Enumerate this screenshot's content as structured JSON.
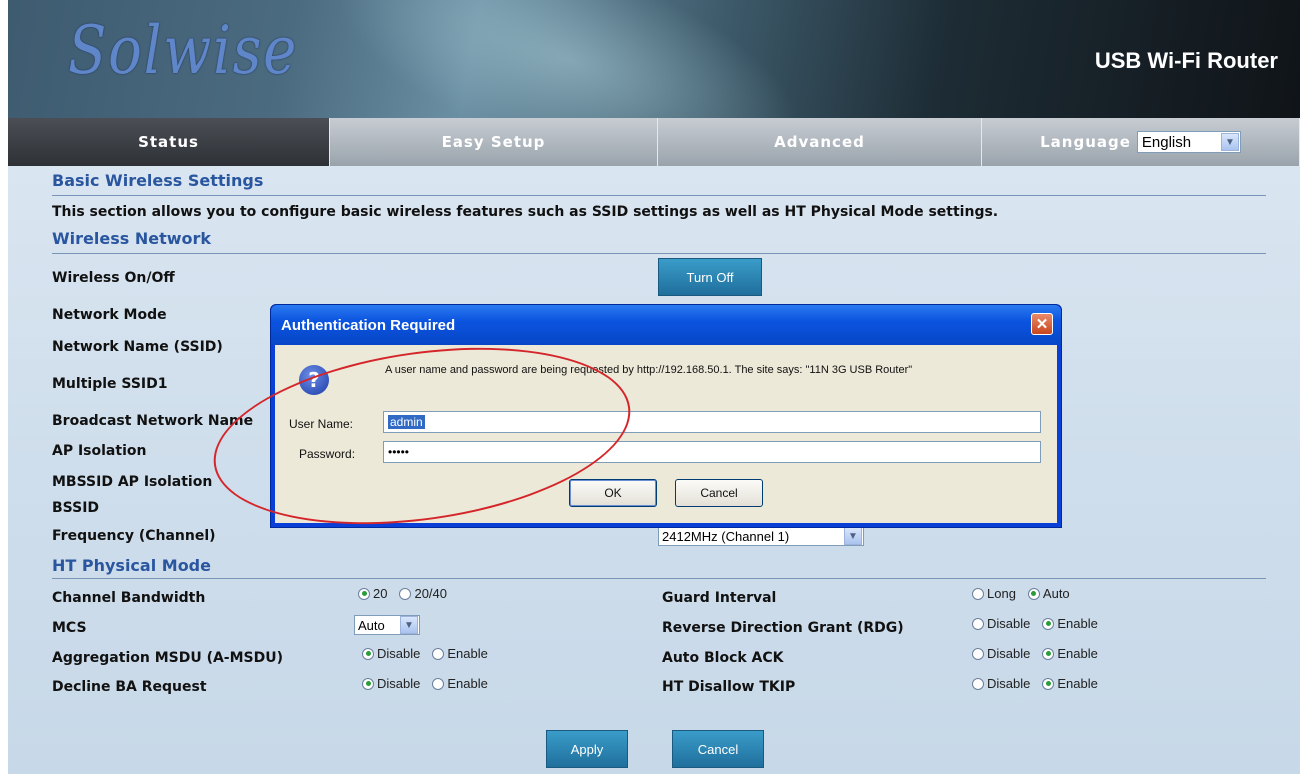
{
  "header": {
    "logo_text": "Solwise",
    "product": "USB Wi-Fi Router"
  },
  "nav": {
    "tabs": [
      {
        "label": "Status"
      },
      {
        "label": "Easy Setup"
      },
      {
        "label": "Advanced"
      }
    ],
    "language_label": "Language",
    "language_value": "English"
  },
  "page": {
    "title": "Basic Wireless Settings",
    "description": "This section allows you to configure basic wireless features such as SSID settings as well as HT Physical Mode settings.",
    "wireless_section": "Wireless Network",
    "fields": {
      "wireless_onoff": "Wireless On/Off",
      "network_mode": "Network Mode",
      "ssid": "Network Name (SSID)",
      "multiple_ssid": "Multiple SSID1",
      "broadcast": "Broadcast Network Name",
      "ap_isolation": "AP Isolation",
      "mbssid_isolation": "MBSSID AP Isolation",
      "bssid": "BSSID",
      "frequency": "Frequency (Channel)"
    },
    "turn_off_button": "Turn Off",
    "frequency_value": "2412MHz (Channel 1)",
    "ht_section": "HT Physical Mode",
    "ht": {
      "channel_bandwidth": {
        "label": "Channel Bandwidth",
        "options": [
          "20",
          "20/40"
        ],
        "selected": "20"
      },
      "mcs": {
        "label": "MCS",
        "value": "Auto"
      },
      "amsdu": {
        "label": "Aggregation MSDU (A-MSDU)",
        "options": [
          "Disable",
          "Enable"
        ],
        "selected": "Disable"
      },
      "decline_ba": {
        "label": "Decline BA Request",
        "options": [
          "Disable",
          "Enable"
        ],
        "selected": "Disable"
      },
      "guard_interval": {
        "label": "Guard Interval",
        "options": [
          "Long",
          "Auto"
        ],
        "selected": "Auto"
      },
      "rdg": {
        "label": "Reverse Direction Grant (RDG)",
        "options": [
          "Disable",
          "Enable"
        ],
        "selected": "Enable"
      },
      "auto_block_ack": {
        "label": "Auto Block ACK",
        "options": [
          "Disable",
          "Enable"
        ],
        "selected": "Enable"
      },
      "ht_disallow_tkip": {
        "label": "HT Disallow TKIP",
        "options": [
          "Disable",
          "Enable"
        ],
        "selected": "Enable"
      }
    },
    "apply_button": "Apply",
    "cancel_button": "Cancel"
  },
  "dialog": {
    "title": "Authentication Required",
    "close_glyph": "✕",
    "message": "A user name and password are being requested by http://192.168.50.1. The site says: \"11N 3G USB Router\"",
    "username_label": "User Name:",
    "username_value": "admin",
    "password_label": "Password:",
    "password_value": "•••••",
    "ok_label": "OK",
    "cancel_label": "Cancel"
  },
  "annotation": {
    "color": "#d4262a",
    "shape": "ellipse"
  }
}
